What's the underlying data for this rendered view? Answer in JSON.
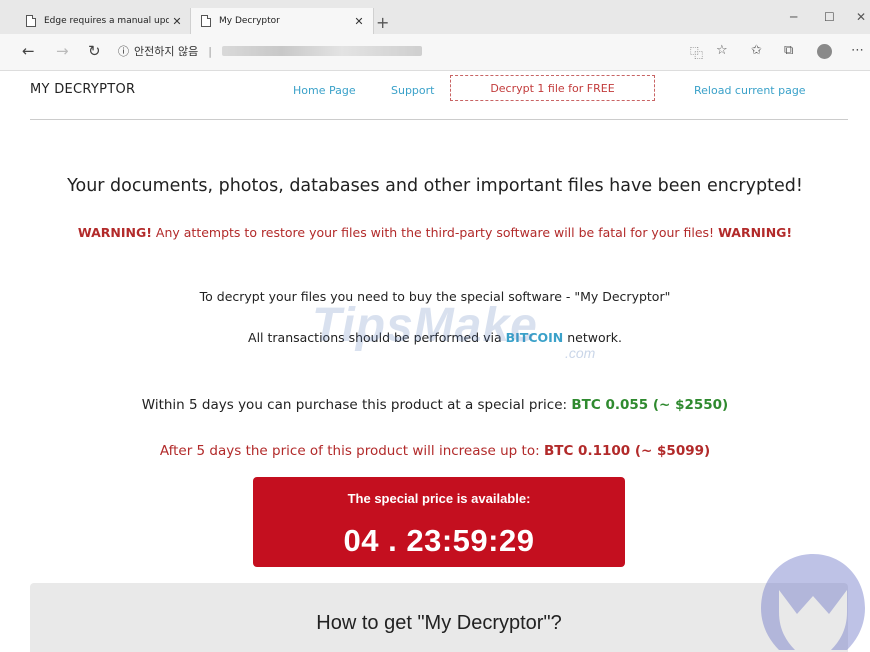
{
  "browser": {
    "tabs": [
      {
        "label": "Edge requires a manual update",
        "close": "✕"
      },
      {
        "label": "My Decryptor",
        "close": "✕"
      }
    ],
    "new_tab": "+",
    "window_controls": {
      "minimize": "─",
      "maximize": "☐",
      "close": "✕"
    },
    "nav": {
      "back": "←",
      "forward": "→",
      "refresh": "↻"
    },
    "address": {
      "info_icon": "ⓘ",
      "security_text": "안전하지 않음",
      "separator": "|"
    },
    "toolbar_icons": {
      "reading_view": "⿻",
      "favorite": "☆",
      "favorites_hub": "✩",
      "collections": "⧉",
      "more": "⋯"
    }
  },
  "site": {
    "brand": "MY DECRYPTOR",
    "nav": {
      "home": "Home Page",
      "support": "Support",
      "decrypt_free": "Decrypt 1 file for FREE",
      "reload": "Reload current page"
    }
  },
  "content": {
    "headline": "Your documents, photos, databases and other important files have been encrypted!",
    "warning_label": "WARNING!",
    "warning_text": "Any attempts to restore your files with the third-party software will be fatal for your files!",
    "warning_label_end": "WARNING!",
    "buy_text": "To decrypt your files you need to buy the special software - \"My Decryptor\"",
    "transactions_before": "All transactions should be performed via",
    "transactions_coin": "BITCOIN",
    "transactions_after": "network.",
    "offer_text": "Within 5 days you can purchase this product at a special price:",
    "offer_price": "BTC 0.055 (~ $2550)",
    "increase_text": "After 5 days the price of this product will increase up to:",
    "increase_price": "BTC 0.1100 (~ $5099)",
    "timer_caption": "The special price is available:",
    "timer_value": "04 . 23:59:29",
    "howto_title": "How to get \"My Decryptor\"?"
  },
  "watermark": {
    "main": "TipsMake",
    "suffix": ".com"
  },
  "colors": {
    "link": "#3aa1c9",
    "warning": "#b22a2a",
    "price_green": "#2f8a2f",
    "timer_bg": "#c40f1f"
  }
}
